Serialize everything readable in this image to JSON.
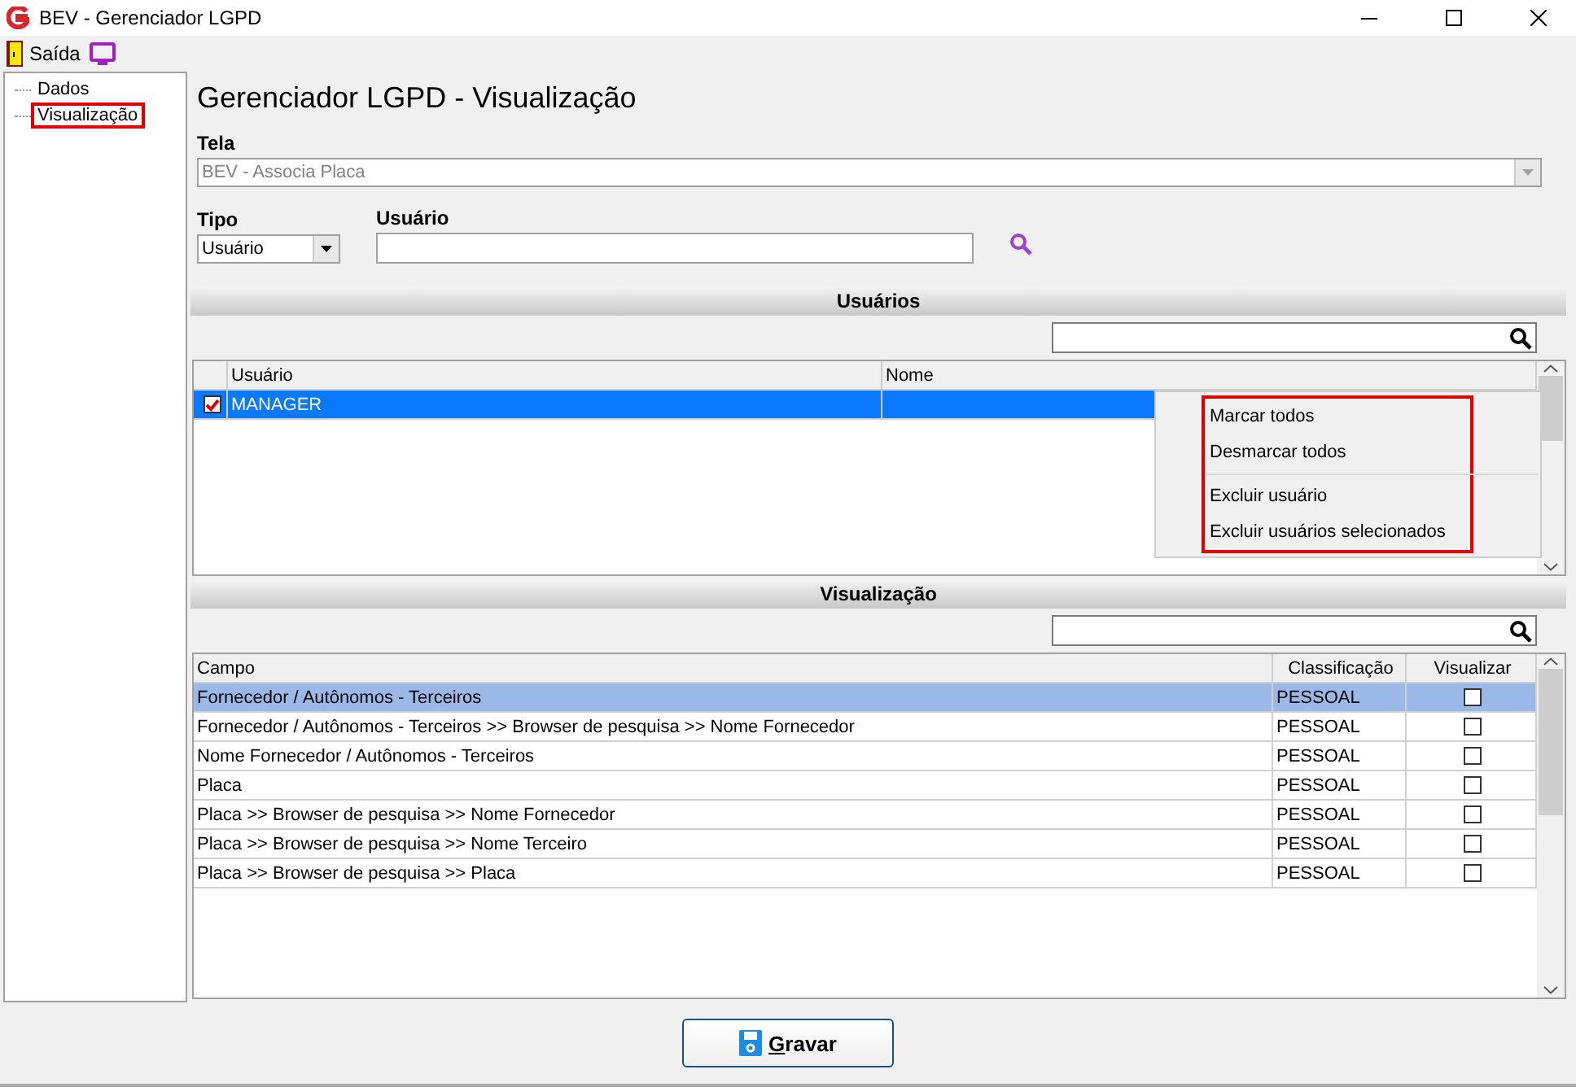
{
  "window": {
    "title": "BEV - Gerenciador LGPD"
  },
  "toolbar": {
    "exit_label": "Saída"
  },
  "sidebar": {
    "items": [
      {
        "label": "Dados",
        "highlighted": false
      },
      {
        "label": "Visualização",
        "highlighted": true
      }
    ]
  },
  "heading": "Gerenciador LGPD - Visualização",
  "form": {
    "tela": {
      "label": "Tela",
      "value": "BEV - Associa Placa",
      "disabled": true
    },
    "tipo": {
      "label": "Tipo",
      "value": "Usuário"
    },
    "usuario": {
      "label": "Usuário"
    }
  },
  "users_section": {
    "title": "Usuários",
    "columns": [
      "Usuário",
      "Nome"
    ],
    "rows": [
      {
        "usuario": "MANAGER",
        "checked": true,
        "selected": true
      }
    ],
    "context_menu": {
      "highlighted": true,
      "items": [
        {
          "label": "Marcar todos",
          "separator_before": false
        },
        {
          "label": "Desmarcar todos",
          "separator_before": false
        },
        {
          "label": "Excluir usuário",
          "separator_before": true
        },
        {
          "label": "Excluir usuários selecionados",
          "separator_before": false
        }
      ]
    }
  },
  "view_section": {
    "title": "Visualização",
    "columns": [
      "Campo",
      "Classificação",
      "Visualizar"
    ],
    "rows": [
      {
        "campo": "Fornecedor / Autônomos - Terceiros",
        "classificacao": "PESSOAL",
        "visualizar": false,
        "selected": true
      },
      {
        "campo": "Fornecedor / Autônomos - Terceiros >> Browser de pesquisa >> Nome Fornecedor",
        "classificacao": "PESSOAL",
        "visualizar": false,
        "selected": false
      },
      {
        "campo": "Nome Fornecedor / Autônomos - Terceiros",
        "classificacao": "PESSOAL",
        "visualizar": false,
        "selected": false
      },
      {
        "campo": "Placa",
        "classificacao": "PESSOAL",
        "visualizar": false,
        "selected": false
      },
      {
        "campo": "Placa >> Browser de pesquisa >> Nome Fornecedor",
        "classificacao": "PESSOAL",
        "visualizar": false,
        "selected": false
      },
      {
        "campo": "Placa >> Browser de pesquisa >> Nome Terceiro",
        "classificacao": "PESSOAL",
        "visualizar": false,
        "selected": false
      },
      {
        "campo": "Placa >> Browser de pesquisa >> Placa",
        "classificacao": "PESSOAL",
        "visualizar": false,
        "selected": false
      }
    ]
  },
  "save_button": "Gravar"
}
